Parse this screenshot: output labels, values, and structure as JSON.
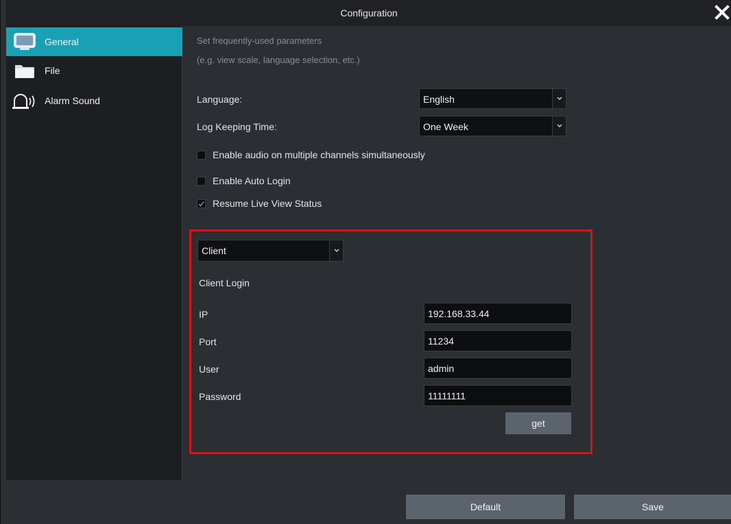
{
  "window": {
    "title": "Configuration"
  },
  "sidebar": {
    "items": [
      {
        "label": "General",
        "icon": "monitor-icon",
        "active": true
      },
      {
        "label": "File",
        "icon": "folder-icon",
        "active": false
      },
      {
        "label": "Alarm Sound",
        "icon": "alarm-bell-icon",
        "active": false
      }
    ]
  },
  "general": {
    "description_line1": "Set frequently-used parameters",
    "description_line2": "(e.g. view scale, language selection, etc.)",
    "language_label": "Language:",
    "language_value": "English",
    "log_keeping_label": "Log Keeping Time:",
    "log_keeping_value": "One Week",
    "checkboxes": [
      {
        "label": "Enable audio on multiple channels simultaneously",
        "checked": false
      },
      {
        "label": "Enable Auto Login",
        "checked": false
      },
      {
        "label": "Resume Live View Status",
        "checked": true
      }
    ]
  },
  "client": {
    "mode_value": "Client",
    "section_title": "Client Login",
    "ip_label": "IP",
    "ip_value": "192.168.33.44",
    "port_label": "Port",
    "port_value": "11234",
    "user_label": "User",
    "user_value": "admin",
    "password_label": "Password",
    "password_value": "11111111",
    "get_button": "get"
  },
  "footer": {
    "default_button": "Default",
    "save_button": "Save"
  },
  "colors": {
    "accent": "#1aa0b4",
    "highlight_border": "#e01010",
    "button": "#5b636d"
  }
}
